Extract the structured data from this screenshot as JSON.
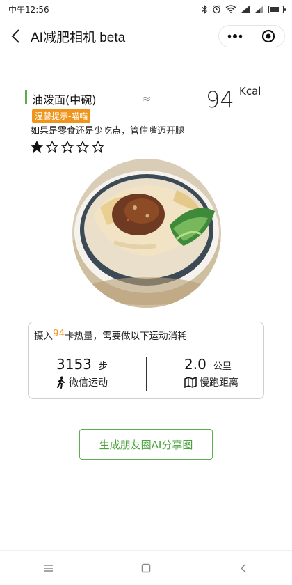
{
  "status_bar": {
    "time": "中午12:56"
  },
  "nav": {
    "title": "AI减肥相机 beta"
  },
  "food": {
    "name": "油泼面(中碗)",
    "approx_symbol": "≈",
    "calories": "94",
    "calorie_unit": "Kcal",
    "tip_badge": "温馨提示-喵喵",
    "tip_text": "如果是零食还是少吃点，管住嘴迈开腿",
    "rating": {
      "filled": 1,
      "total": 5
    }
  },
  "exercise": {
    "headline_prefix": "摄入",
    "headline_value": "94",
    "headline_suffix": "卡热量，需要做以下运动消耗",
    "steps_value": "3153",
    "steps_unit": "步",
    "steps_label": "微信运动",
    "run_value": "2.0",
    "run_unit": "公里",
    "run_label": "慢跑距离"
  },
  "share_button": {
    "label": "生成朋友圈AI分享图"
  },
  "colors": {
    "accent_green": "#59b04a",
    "accent_orange": "#f0951b"
  },
  "icons": [
    "back-arrow-icon",
    "more-dots-icon",
    "target-icon",
    "star-icon",
    "walker-icon",
    "map-icon",
    "menu-icon",
    "home-square-icon",
    "back-triangle-icon",
    "bluetooth-icon",
    "alarm-icon",
    "wifi-icon",
    "signal-icon",
    "battery-icon"
  ],
  "battery_level": 0.8
}
